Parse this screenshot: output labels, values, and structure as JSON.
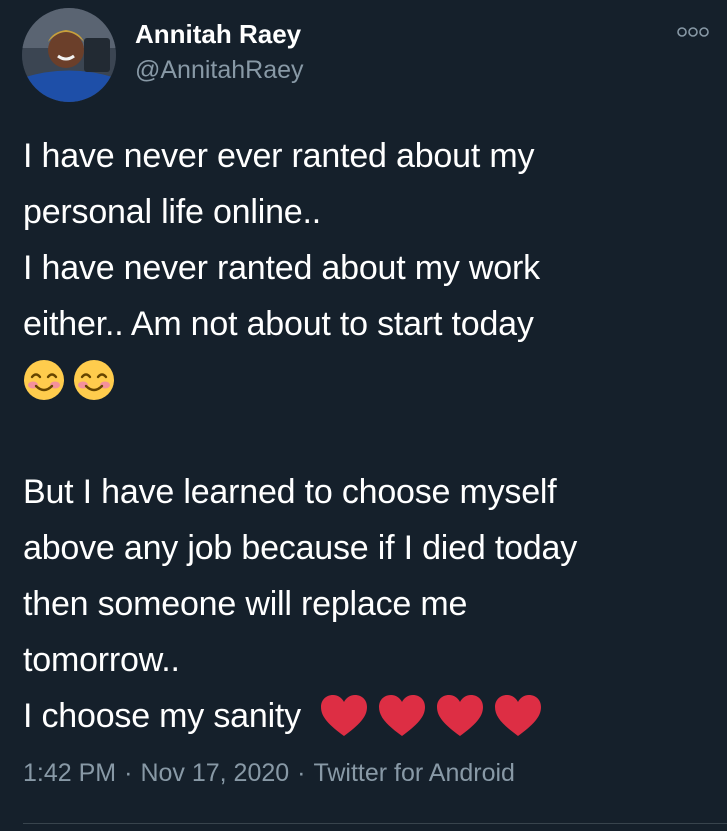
{
  "user": {
    "display_name": "Annitah Raey",
    "handle": "@AnnitahRaey"
  },
  "tweet": {
    "lines": [
      "I have never ever ranted about my",
      "personal life online..",
      "I have never ranted about my work",
      "either.. Am not about to start today"
    ],
    "emoji_line_1": [
      "smiling-face-with-smiling-eyes",
      "smiling-face-with-smiling-eyes"
    ],
    "lines_2": [
      "But I have learned to choose myself",
      "above any job because if I died today",
      "then someone will replace me",
      "tomorrow.."
    ],
    "last_line": "I choose my sanity",
    "emoji_line_2": [
      "red-heart",
      "red-heart",
      "red-heart",
      "red-heart"
    ]
  },
  "meta": {
    "time": "1:42 PM",
    "date": "Nov 17, 2020",
    "source": "Twitter for Android",
    "separator": "·"
  },
  "colors": {
    "background": "#15202b",
    "text": "#ffffff",
    "secondary": "#8899a6",
    "heart": "#dd2e44",
    "emoji_face": "#ffcc4d"
  },
  "icons": {
    "more": "more-options-icon"
  }
}
